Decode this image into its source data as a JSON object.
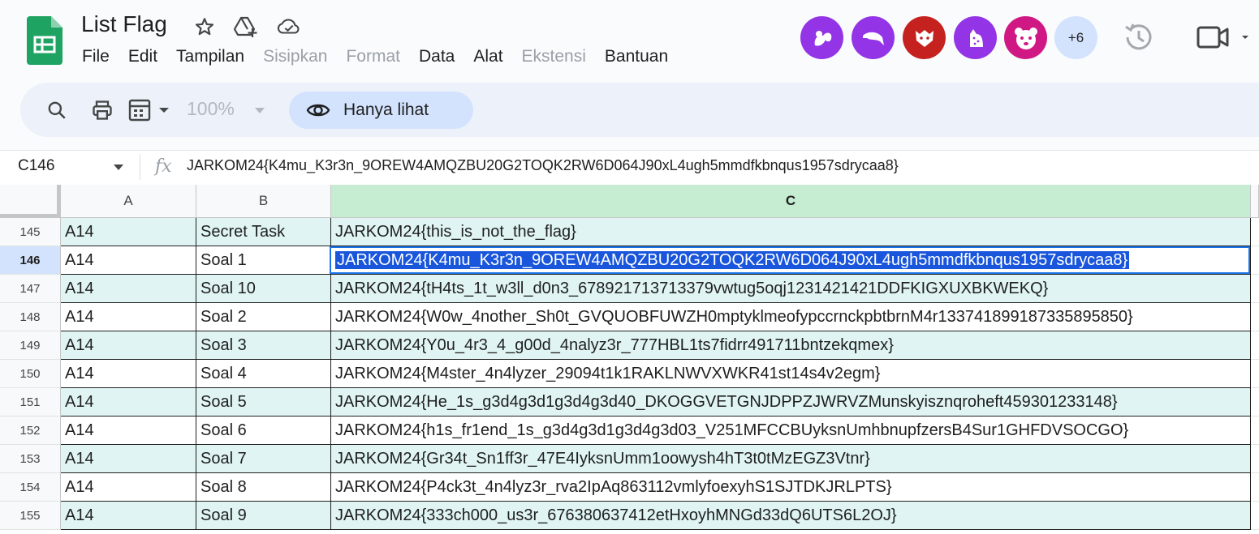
{
  "app": {
    "doc_title": "List Flag",
    "menu": [
      {
        "label": "File",
        "enabled": true
      },
      {
        "label": "Edit",
        "enabled": true
      },
      {
        "label": "Tampilan",
        "enabled": true
      },
      {
        "label": "Sisipkan",
        "enabled": false
      },
      {
        "label": "Format",
        "enabled": false
      },
      {
        "label": "Data",
        "enabled": true
      },
      {
        "label": "Alat",
        "enabled": true
      },
      {
        "label": "Ekstensi",
        "enabled": false
      },
      {
        "label": "Bantuan",
        "enabled": true
      }
    ],
    "collaborators": [
      {
        "icon": "squirrel-avatar-icon",
        "color": "#9334e6"
      },
      {
        "icon": "dolphin-avatar-icon",
        "color": "#9334e6"
      },
      {
        "icon": "wolverine-avatar-icon",
        "color": "#c5221f"
      },
      {
        "icon": "cheetah-avatar-icon",
        "color": "#9334e6"
      },
      {
        "icon": "panda-avatar-icon",
        "color": "#d01884"
      }
    ],
    "more_collaborators": "+6"
  },
  "toolbar": {
    "zoom": "100%",
    "view_only_label": "Hanya lihat"
  },
  "formula_bar": {
    "cell_ref": "C146",
    "fx": "fx",
    "value": "JARKOM24{K4mu_K3r3n_9OREW4AMQZBU20G2TOQK2RW6D064J90xL4ugh5mmdfkbnqus1957sdrycaa8}"
  },
  "grid": {
    "columns": [
      "A",
      "B",
      "C"
    ],
    "selected_row": "146",
    "rows": [
      {
        "num": "145",
        "a": "A14",
        "b": "Secret Task",
        "c": "JARKOM24{this_is_not_the_flag}"
      },
      {
        "num": "146",
        "a": "A14",
        "b": "Soal 1",
        "c": "JARKOM24{K4mu_K3r3n_9OREW4AMQZBU20G2TOQK2RW6D064J90xL4ugh5mmdfkbnqus1957sdrycaa8}"
      },
      {
        "num": "147",
        "a": "A14",
        "b": "Soal 10",
        "c": "JARKOM24{tH4ts_1t_w3ll_d0n3_678921713713379vwtug5oqj1231421421DDFKIGXUXBKWEKQ}"
      },
      {
        "num": "148",
        "a": "A14",
        "b": "Soal 2",
        "c": "JARKOM24{W0w_4nother_Sh0t_GVQUOBFUWZH0mptyklmeofypccrnckpbtbrnM4r133741899187335895850}"
      },
      {
        "num": "149",
        "a": "A14",
        "b": "Soal 3",
        "c": "JARKOM24{Y0u_4r3_4_g00d_4nalyz3r_777HBL1ts7fidrr491711bntzekqmex}"
      },
      {
        "num": "150",
        "a": "A14",
        "b": "Soal 4",
        "c": "JARKOM24{M4ster_4n4lyzer_29094t1k1RAKLNWVXWKR41st14s4v2egm}"
      },
      {
        "num": "151",
        "a": "A14",
        "b": "Soal 5",
        "c": "JARKOM24{He_1s_g3d4g3d1g3d4g3d40_DKOGGVETGNJDPPZJWRVZMunskyisznqroheft459301233148}"
      },
      {
        "num": "152",
        "a": "A14",
        "b": "Soal 6",
        "c": "JARKOM24{h1s_fr1end_1s_g3d4g3d1g3d4g3d03_V251MFCCBUyksnUmhbnupfzersB4Sur1GHFDVSOCGO}"
      },
      {
        "num": "153",
        "a": "A14",
        "b": "Soal 7",
        "c": "JARKOM24{Gr34t_Sn1ff3r_47E4IyksnUmm1oowysh4hT3t0tMzEGZ3Vtnr}"
      },
      {
        "num": "154",
        "a": "A14",
        "b": "Soal 8",
        "c": "JARKOM24{P4ck3t_4n4lyz3r_rva2IpAq863112vmlyfoexyhS1SJTDKJRLPTS}"
      },
      {
        "num": "155",
        "a": "A14",
        "b": "Soal 9",
        "c": "JARKOM24{333ch000_us3r_676380637412etHxoyhMNGd33dQ6UTS6L2OJ}"
      }
    ]
  }
}
